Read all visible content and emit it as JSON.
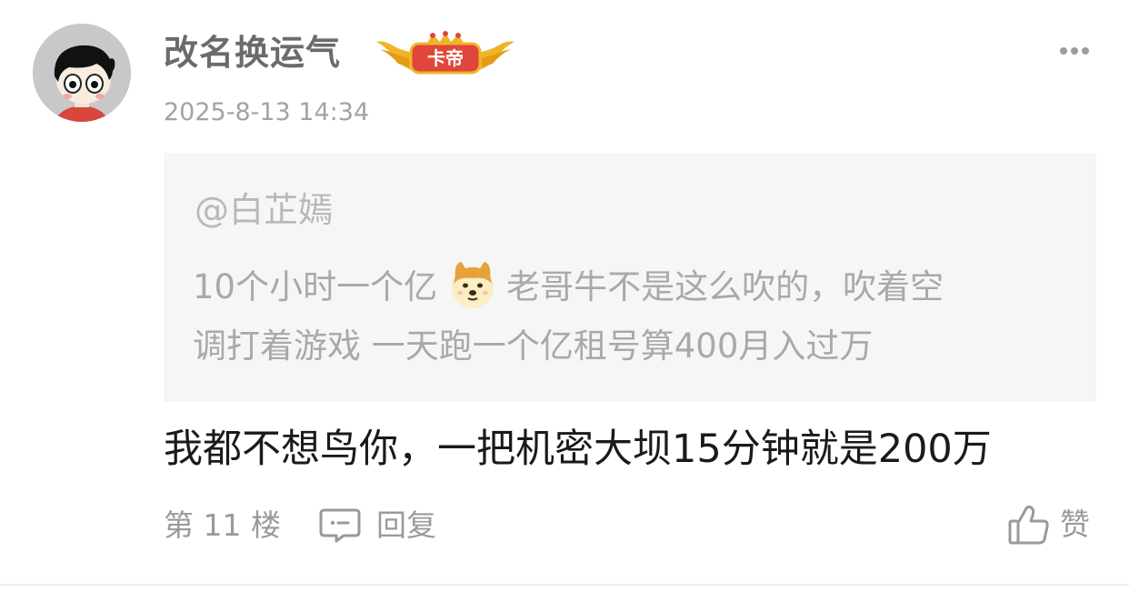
{
  "post": {
    "username": "改名换运气",
    "badge_label": "卡帝",
    "timestamp": "2025-8-13 14:34",
    "quote": {
      "user": "@白芷嫣",
      "line1_before": "10个小时一个亿",
      "emoji": "doge-emoji",
      "line1_after": "老哥牛不是这么吹的，吹着空",
      "line2": "调打着游戏  一天跑一个亿租号算400月入过万"
    },
    "text": "我都不想鸟你，一把机密大坝15分钟就是200万",
    "floor": "第 11 楼",
    "reply_label": "回复",
    "like_label": "赞"
  },
  "icons": {
    "more": "more-dots-icon",
    "reply": "comment-icon",
    "like": "thumbs-up-icon"
  },
  "colors": {
    "badge_red": "#e0463b",
    "badge_gold": "#f0b429",
    "quote_bg": "#f6f6f6",
    "muted_text": "#a9a9a9"
  }
}
